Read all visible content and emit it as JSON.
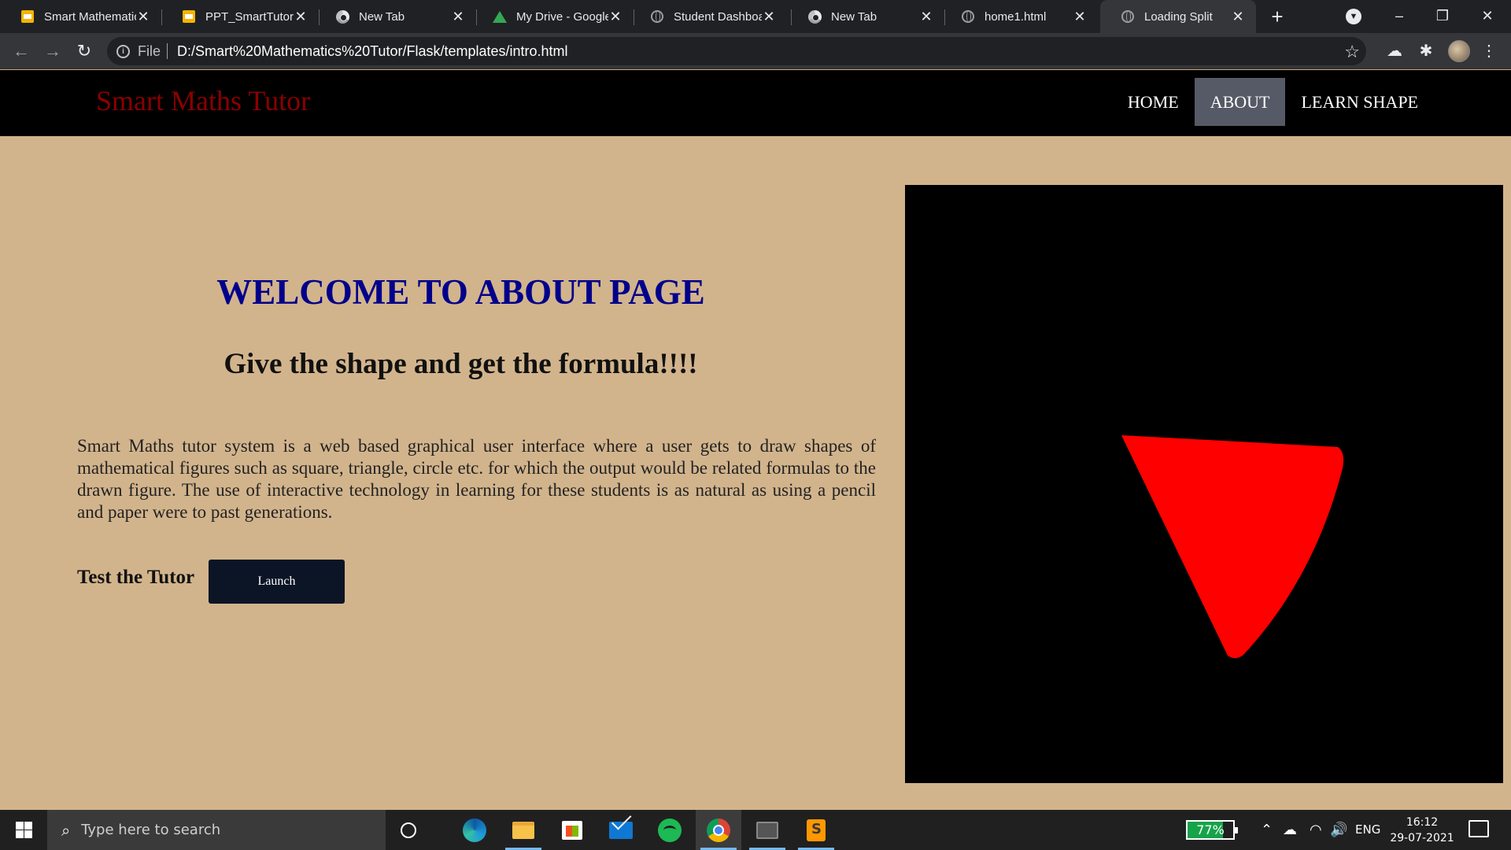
{
  "browser": {
    "tabs": [
      {
        "title": "Smart Mathematics Tutor",
        "icon": "slides-icon"
      },
      {
        "title": "PPT_SmartTutor - Google Slides",
        "icon": "slides-icon"
      },
      {
        "title": "New Tab",
        "icon": "chrome-icon"
      },
      {
        "title": "My Drive - Google Drive",
        "icon": "drive-icon"
      },
      {
        "title": "Student Dashboard",
        "icon": "globe-icon"
      },
      {
        "title": "New Tab",
        "icon": "chrome-icon"
      },
      {
        "title": "home1.html",
        "icon": "globe-icon"
      },
      {
        "title": "Loading Split",
        "icon": "globe-icon",
        "active": true
      }
    ],
    "address": {
      "scheme_label": "File",
      "url": "D:/Smart%20Mathematics%20Tutor/Flask/templates/intro.html"
    }
  },
  "site": {
    "brand": "Smart Maths Tutor",
    "nav": {
      "home": "HOME",
      "about": "ABOUT",
      "learn": "LEARN SHAPE",
      "active": "about"
    }
  },
  "page": {
    "title": "WELCOME TO ABOUT PAGE",
    "subtitle": "Give the shape and get the formula!!!!",
    "description": "Smart Maths tutor system is a web based graphical user interface where a user gets to draw shapes of mathematical figures such as square, triangle, circle etc. for which the output would be related formulas to the drawn figure. The use of interactive technology in learning for these students is as natural as using a pencil and paper were to past generations.",
    "test_label": "Test the Tutor",
    "launch_label": "Launch",
    "canvas": {
      "background": "#000000",
      "shape_color": "#ff0000",
      "shape": "triangle"
    }
  },
  "taskbar": {
    "search_placeholder": "Type here to search",
    "battery_percent": 77,
    "battery_label": "77%",
    "language": "ENG",
    "time": "16:12",
    "date": "29-07-2021"
  },
  "colors": {
    "page_bg": "#d2b48c",
    "brand": "#8b0000",
    "title": "#00008b",
    "nav_active": "#555a66",
    "launch_bg": "#0b1526"
  }
}
